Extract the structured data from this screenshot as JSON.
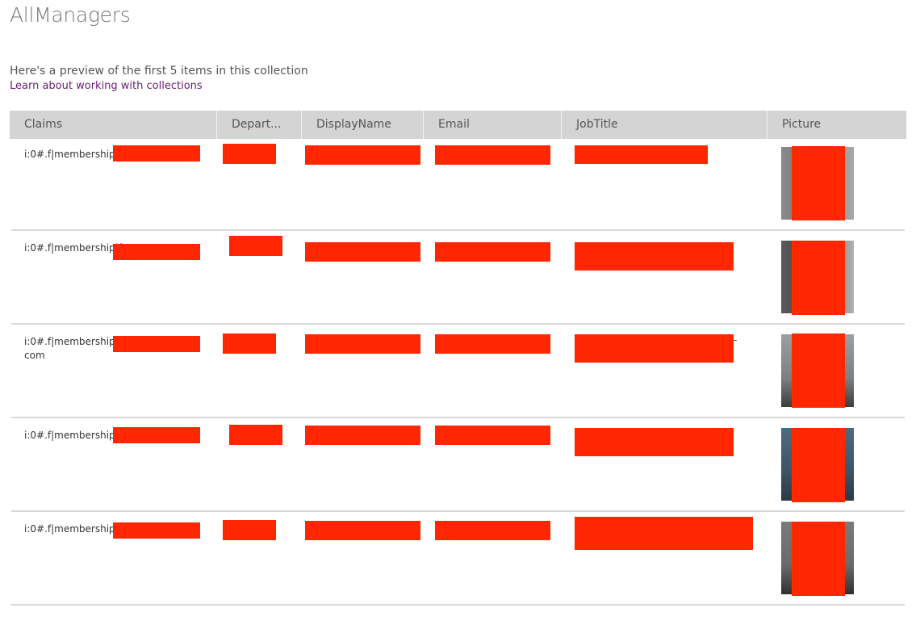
{
  "collection": {
    "title": "AllManagers",
    "preview_text": "Here's a preview of the first 5 items in this collection",
    "learn_link": "Learn about working with collections"
  },
  "columns": [
    "Claims",
    "Depart...",
    "DisplayName",
    "Email",
    "JobTitle",
    "Picture"
  ],
  "rows": [
    {
      "claims_prefix": "i:0#.f|membership|c",
      "claims_line2": ""
    },
    {
      "claims_prefix": "i:0#.f|membership|f",
      "claims_line2": ""
    },
    {
      "claims_prefix": "i:0#.f|membership|c",
      "claims_line2": "com"
    },
    {
      "claims_prefix": "i:0#.f|membership|j",
      "claims_line2": ""
    },
    {
      "claims_prefix": "i:0#.f|membership|k",
      "claims_line2": ""
    }
  ],
  "redaction_color": "#ff2600",
  "accent_link_color": "#6a2077"
}
